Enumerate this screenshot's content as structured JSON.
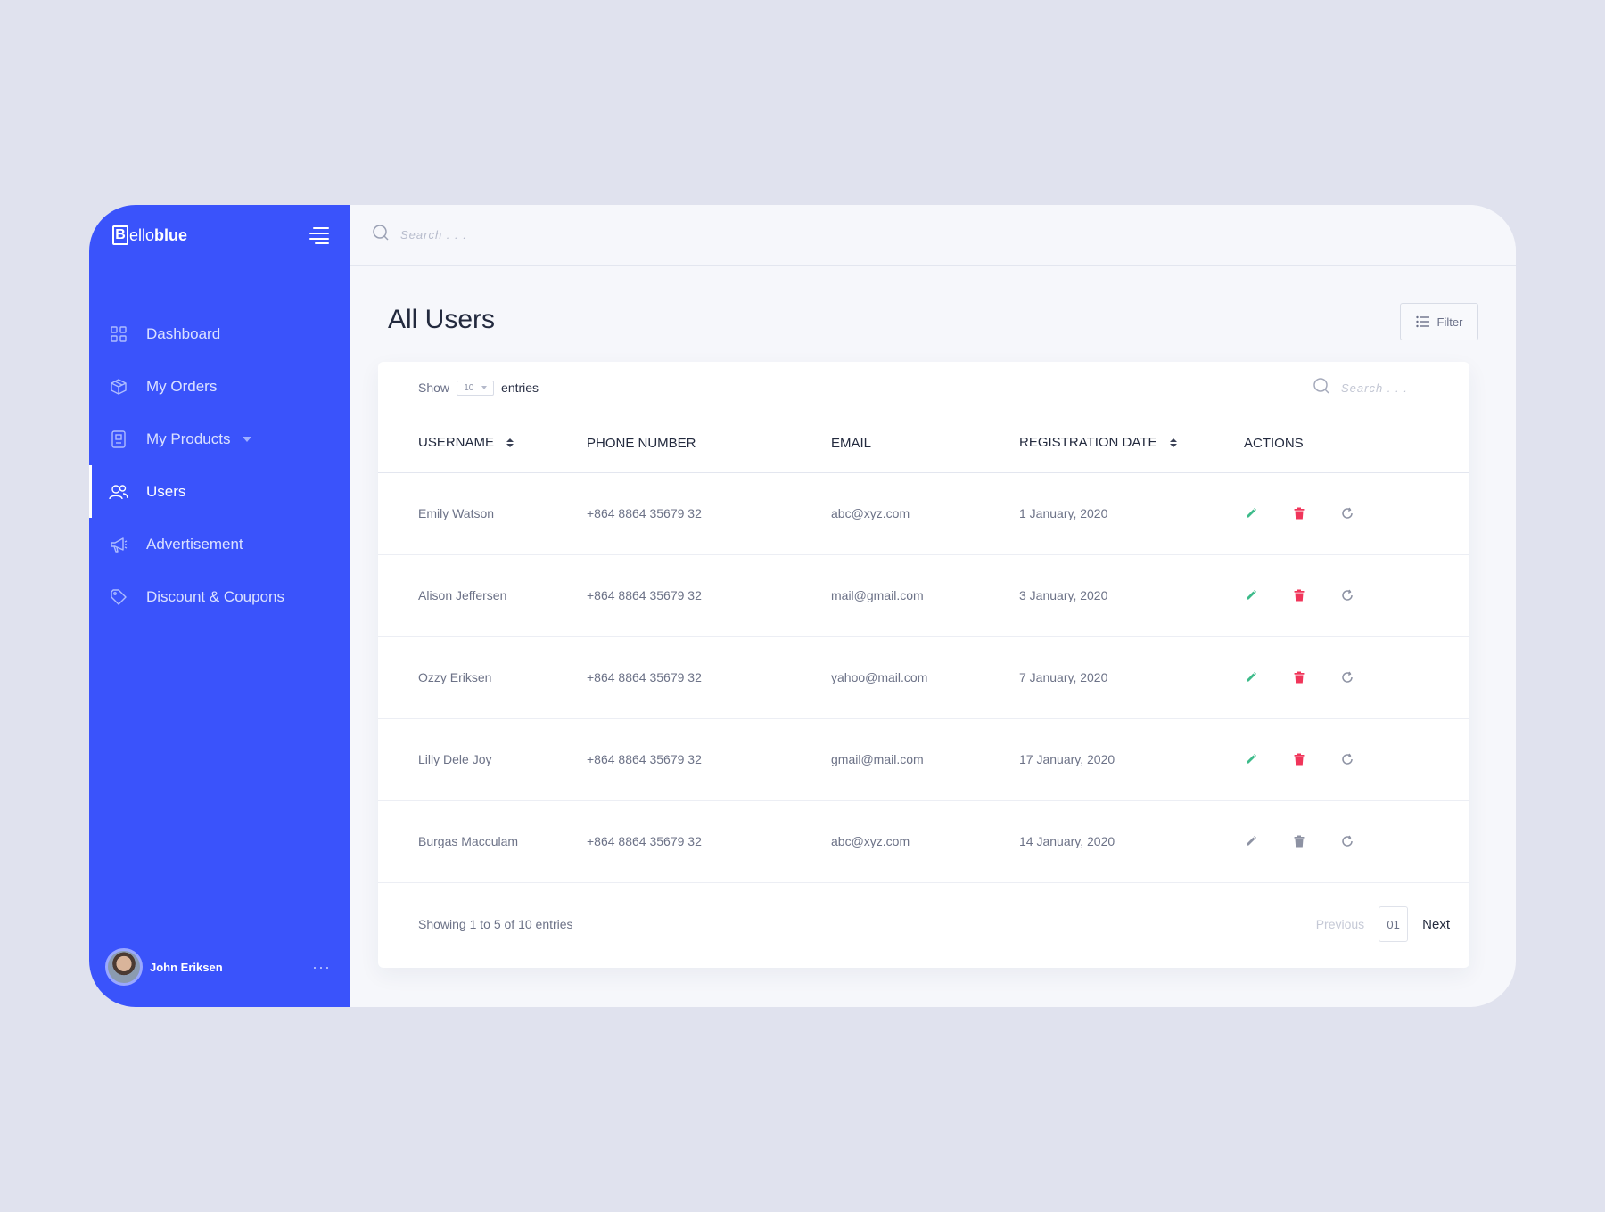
{
  "brand": {
    "logo_letter": "B",
    "name_part1": "ello",
    "name_part2": "blue"
  },
  "topbar": {
    "search_placeholder": "Search . . ."
  },
  "sidebar": {
    "items": [
      {
        "label": "Dashboard",
        "icon": "grid-icon",
        "active": false
      },
      {
        "label": "My Orders",
        "icon": "box-icon",
        "active": false
      },
      {
        "label": "My Products",
        "icon": "product-icon",
        "active": false,
        "has_dropdown": true
      },
      {
        "label": "Users",
        "icon": "users-icon",
        "active": true
      },
      {
        "label": "Advertisement",
        "icon": "megaphone-icon",
        "active": false
      },
      {
        "label": "Discount & Coupons",
        "icon": "tag-icon",
        "active": false
      }
    ],
    "profile": {
      "name": "John Eriksen",
      "more": "···"
    }
  },
  "page": {
    "title": "All Users",
    "filter_label": "Filter"
  },
  "table_controls": {
    "show_label": "Show",
    "entries_value": "10",
    "entries_label": "entries",
    "search_placeholder": "Search . . ."
  },
  "table": {
    "columns": [
      "USERNAME",
      "PHONE NUMBER",
      "EMAIL",
      "REGISTRATION DATE",
      "ACTIONS"
    ],
    "rows": [
      [
        "Emily Watson",
        "+864 8864 35679 32",
        "abc@xyz.com",
        "1 January, 2020"
      ],
      [
        "Alison Jeffersen",
        "+864 8864 35679 32",
        "mail@gmail.com",
        "3 January, 2020"
      ],
      [
        "Ozzy Eriksen",
        "+864 8864 35679 32",
        "yahoo@mail.com",
        "7 January, 2020"
      ],
      [
        "Lilly Dele Joy",
        "+864 8864 35679 32",
        "gmail@mail.com",
        "17 January, 2020"
      ],
      [
        "Burgas Macculam",
        "+864 8864 35679 32",
        "abc@xyz.com",
        "14 January, 2020"
      ]
    ]
  },
  "footer": {
    "showing_text": "Showing 1 to 5 of 10 entries",
    "previous_label": "Previous",
    "page_number": "01",
    "next_label": "Next"
  },
  "colors": {
    "sidebar_bg": "#3a53fb",
    "edit_active": "#3dbb8a",
    "delete_active": "#f0355a",
    "muted_action": "#8d92a3"
  }
}
